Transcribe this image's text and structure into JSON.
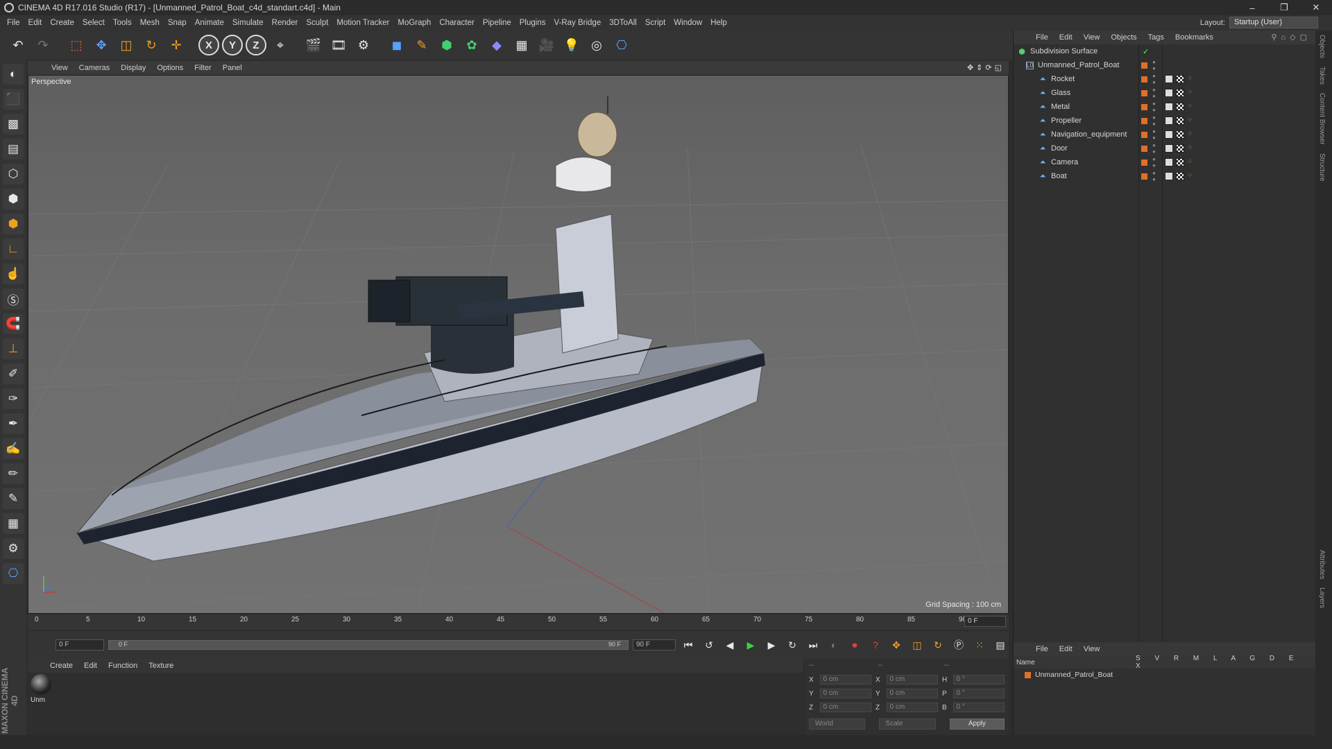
{
  "window": {
    "title": "CINEMA 4D R17.016 Studio (R17) - [Unmanned_Patrol_Boat_c4d_standart.c4d] - Main",
    "controls": [
      "–",
      "❐",
      "✕"
    ]
  },
  "menu": [
    "File",
    "Edit",
    "Create",
    "Select",
    "Tools",
    "Mesh",
    "Snap",
    "Animate",
    "Simulate",
    "Render",
    "Sculpt",
    "Motion Tracker",
    "MoGraph",
    "Character",
    "Pipeline",
    "Plugins",
    "V-Ray Bridge",
    "3DToAll",
    "Script",
    "Window",
    "Help"
  ],
  "layout": {
    "label": "Layout:",
    "value": "Startup (User)"
  },
  "toolbar": {
    "axis_x": "X",
    "axis_y": "Y",
    "axis_z": "Z"
  },
  "viewport": {
    "menu": [
      "View",
      "Cameras",
      "Display",
      "Options",
      "Filter",
      "Panel"
    ],
    "label": "Perspective",
    "grid_spacing": "Grid Spacing : 100 cm"
  },
  "timeline": {
    "ticks": [
      "0",
      "5",
      "10",
      "15",
      "20",
      "25",
      "30",
      "35",
      "40",
      "45",
      "50",
      "55",
      "60",
      "65",
      "70",
      "75",
      "80",
      "85",
      "90"
    ],
    "current_frame": "0 F"
  },
  "playback": {
    "start": "0 F",
    "slider_start": "0 F",
    "slider_end": "90 F",
    "end": "90 F"
  },
  "material_manager": {
    "menu": [
      "Create",
      "Edit",
      "Function",
      "Texture"
    ],
    "material_name": "Unm"
  },
  "coordinates": {
    "header_pos": "--",
    "header_size": "--",
    "header_rot": "--",
    "rows": [
      {
        "l1": "X",
        "v1": "0 cm",
        "l2": "X",
        "v2": "0 cm",
        "l3": "H",
        "v3": "0 °"
      },
      {
        "l1": "Y",
        "v1": "0 cm",
        "l2": "Y",
        "v2": "0 cm",
        "l3": "P",
        "v3": "0 °"
      },
      {
        "l1": "Z",
        "v1": "0 cm",
        "l2": "Z",
        "v2": "0 cm",
        "l3": "B",
        "v3": "0 °"
      }
    ],
    "mode": "World",
    "size_mode": "Scale",
    "apply": "Apply"
  },
  "object_manager": {
    "menu": [
      "File",
      "Edit",
      "View",
      "Objects",
      "Tags",
      "Bookmarks"
    ],
    "root": "Subdivision Surface",
    "group": "Unmanned_Patrol_Boat",
    "children": [
      "Rocket",
      "Glass",
      "Metal",
      "Propeller",
      "Navigation_equipment",
      "Door",
      "Camera",
      "Boat"
    ]
  },
  "layer_manager": {
    "menu": [
      "File",
      "Edit",
      "View"
    ],
    "col_name": "Name",
    "cols": "S V R M L A G D E X",
    "row": "Unmanned_Patrol_Boat"
  },
  "right_tabs": [
    "Objects",
    "Takes",
    "Content Browser",
    "Structure",
    "Attributes",
    "Layers"
  ],
  "brand": "MAXON CINEMA 4D",
  "colors": {
    "accent": "#e07028",
    "bg": "#2d2d2d",
    "viewport": "#6a6a6a"
  }
}
